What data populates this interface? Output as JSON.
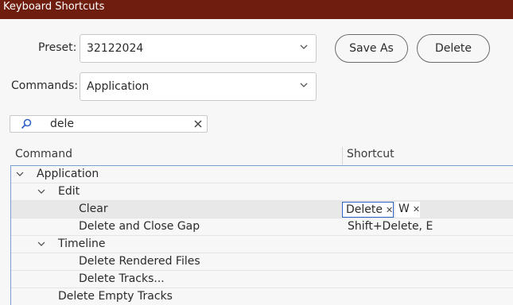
{
  "window": {
    "title": "Keyboard Shortcuts"
  },
  "preset": {
    "label": "Preset:",
    "value": "32122024"
  },
  "commands": {
    "label": "Commands:",
    "value": "Application"
  },
  "buttons": {
    "save_as": "Save As",
    "delete": "Delete"
  },
  "search": {
    "value": "dele"
  },
  "columns": {
    "command": "Command",
    "shortcut": "Shortcut"
  },
  "tree": {
    "application": "Application",
    "edit": "Edit",
    "clear": "Clear",
    "clear_shortcuts": [
      "Delete",
      "W"
    ],
    "delete_close_gap": "Delete and Close Gap",
    "delete_close_gap_shortcut": "Shift+Delete, E",
    "timeline": "Timeline",
    "delete_rendered": "Delete Rendered Files",
    "delete_tracks": "Delete Tracks...",
    "delete_empty": "Delete Empty Tracks"
  },
  "icons": {
    "chevron": "chevron-down-icon",
    "search": "search-icon",
    "clear": "close-icon",
    "expand": "expand-arrow-icon"
  },
  "colors": {
    "titlebar": "#6e1d0e",
    "selection_border": "#2f63c7",
    "tree_border": "#7aa0d0",
    "search_icon": "#2f63c7"
  }
}
